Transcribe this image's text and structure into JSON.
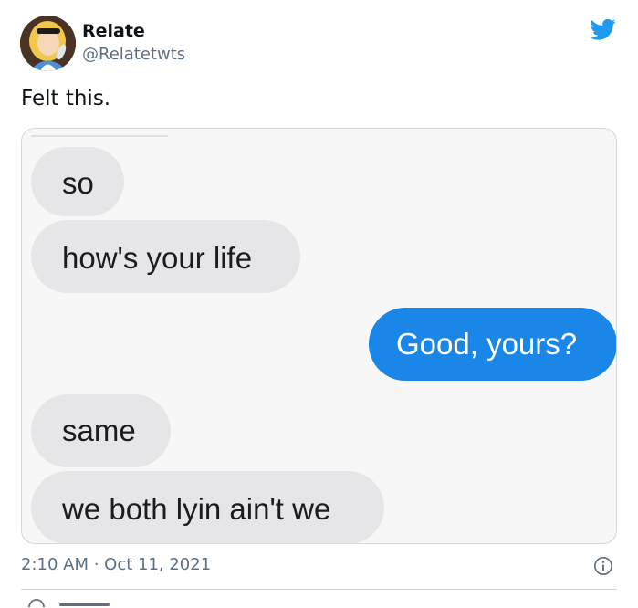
{
  "tweet": {
    "author_name": "Relate",
    "author_handle": "@Relatetwts",
    "text": "Felt this.",
    "timestamp": "2:10 AM · Oct 11, 2021",
    "brand_color": "#1d9bf0",
    "icons": {
      "platform": "twitter-bird-icon",
      "info": "info-icon",
      "reply": "reply-icon"
    }
  },
  "media": {
    "messages": [
      {
        "text": "so",
        "side": "received"
      },
      {
        "text": "how's your life",
        "side": "received"
      },
      {
        "text": "Good, yours?",
        "side": "sent"
      },
      {
        "text": "same",
        "side": "received"
      },
      {
        "text": "we both lyin ain't we",
        "side": "received"
      }
    ],
    "colors": {
      "received_bubble": "#e6e6e8",
      "sent_bubble": "#1a86e8"
    }
  }
}
